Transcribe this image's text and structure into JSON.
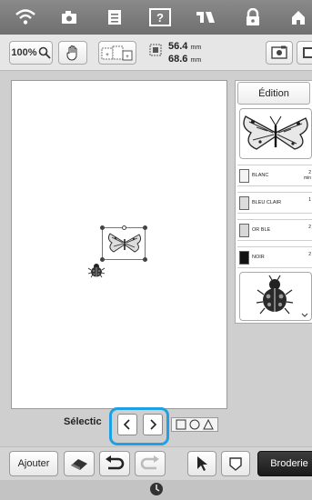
{
  "toolbar": {
    "zoom_label": "100%",
    "width_value": "56.4",
    "height_value": "68.6",
    "unit": "mm"
  },
  "panel": {
    "edition_label": "Édition",
    "threads": [
      {
        "name": "BLANC",
        "num": "2",
        "sub": "min",
        "color": "#f4f4f4"
      },
      {
        "name": "BLEU CLAIR",
        "num": "1",
        "sub": "",
        "color": "#dcdcdc"
      },
      {
        "name": "OR BLE",
        "num": "2",
        "sub": "",
        "color": "#d8d8d8"
      },
      {
        "name": "NOIR",
        "num": "2",
        "sub": "",
        "color": "#111111"
      }
    ]
  },
  "selection": {
    "label": "Sélectic"
  },
  "bottom": {
    "add_label": "Ajouter",
    "embroider_label": "Broderie"
  },
  "icons": {
    "wifi": "wifi-icon",
    "camera": "camera-icon",
    "document": "document-icon",
    "help": "help-icon",
    "sewing": "sewing-icon",
    "lock": "lock-icon",
    "home": "home-icon"
  }
}
